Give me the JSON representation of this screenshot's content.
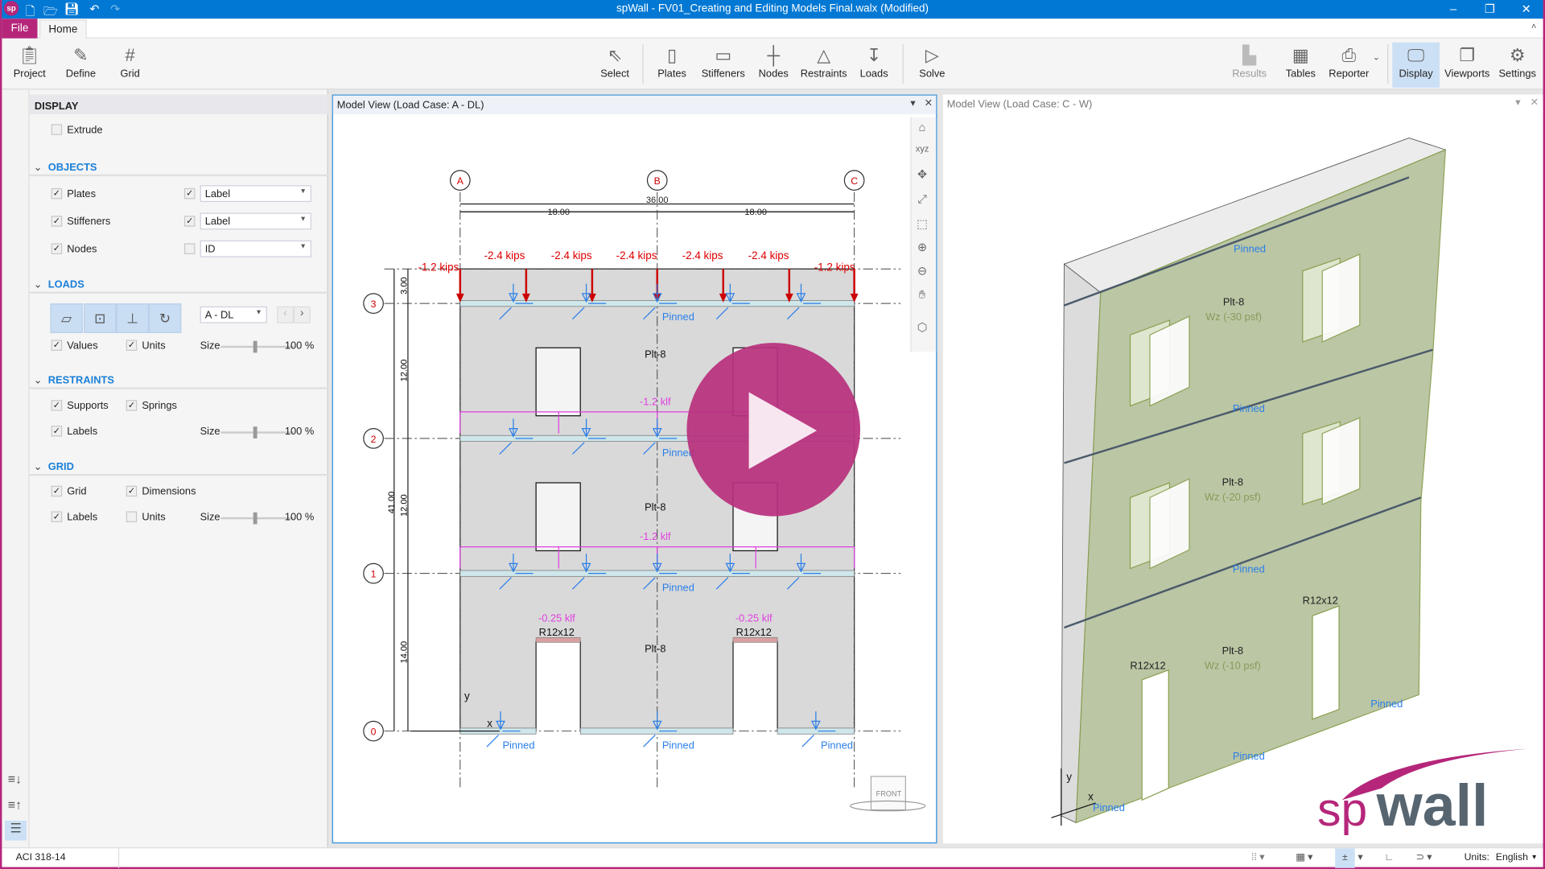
{
  "app": {
    "title": "spWall - FV01_Creating and Editing Models Final.walx (Modified)",
    "logo_text": "sp",
    "brand_color": "#b5267a",
    "titlebar_color": "#0078d4"
  },
  "quick_access": {
    "icons": [
      "new-file-icon",
      "open-folder-icon",
      "save-icon",
      "undo-icon",
      "redo-icon"
    ]
  },
  "window_controls": {
    "minimize": "–",
    "restore": "❐",
    "close": "✕"
  },
  "tabs": {
    "file": "File",
    "home": "Home"
  },
  "ribbon": {
    "project": "Project",
    "define": "Define",
    "grid": "Grid",
    "select": "Select",
    "plates": "Plates",
    "stiffeners": "Stiffeners",
    "nodes": "Nodes",
    "restraints": "Restraints",
    "loads": "Loads",
    "solve": "Solve",
    "results": "Results",
    "tables": "Tables",
    "reporter": "Reporter",
    "display": "Display",
    "viewports": "Viewports",
    "settings": "Settings"
  },
  "panel": {
    "title": "DISPLAY",
    "extrude": {
      "label": "Extrude",
      "checked": false
    },
    "objects": {
      "header": "OBJECTS",
      "rows": [
        {
          "label": "Plates",
          "checked": true,
          "show_label": true,
          "option": "Label"
        },
        {
          "label": "Stiffeners",
          "checked": true,
          "show_label": true,
          "option": "Label"
        },
        {
          "label": "Nodes",
          "checked": true,
          "show_label": false,
          "option": "ID"
        }
      ]
    },
    "loads": {
      "header": "LOADS",
      "load_case": "A - DL",
      "values": "Values",
      "units": "Units",
      "size_label": "Size",
      "size": "100 %"
    },
    "restraints": {
      "header": "RESTRAINTS",
      "supports": "Supports",
      "springs": "Springs",
      "labels": "Labels",
      "size_label": "Size",
      "size": "100 %"
    },
    "grid": {
      "header": "GRID",
      "grid": "Grid",
      "dimensions": "Dimensions",
      "labels": "Labels",
      "units": "Units",
      "size_label": "Size",
      "size": "100 %"
    }
  },
  "view_left": {
    "title": "Model View (Load Case: A - DL)",
    "grid_x": [
      "A",
      "B",
      "C"
    ],
    "grid_y": [
      "3",
      "2",
      "1",
      "0"
    ],
    "dim_total": "36.00",
    "dim_spans": [
      "18.00",
      "18.00"
    ],
    "dim_vertical": [
      "3.00",
      "12.00",
      "41.00",
      "12.00",
      "14.00"
    ],
    "point_loads": [
      "-1.2 kips",
      "-2.4 kips",
      "-2.4 kips",
      "-2.4 kips",
      "-2.4 kips",
      "-2.4 kips",
      "-1.2 kips"
    ],
    "line_loads": [
      "-1.2 klf",
      "-1.2 klf",
      "-0.25 klf",
      "-0.25 klf"
    ],
    "stiffeners": [
      "R12x12",
      "R12x12"
    ],
    "plates": [
      "Plt-8",
      "Plt-8",
      "Plt-8"
    ],
    "restraint_label": "Pinned",
    "axis_x": "x",
    "axis_y": "y",
    "view_cube": "FRONT",
    "play_button_color": "#b8307d"
  },
  "view_right": {
    "title": "Model View (Load Case: C - W)",
    "plates": [
      {
        "name": "Plt-8",
        "load": "Wz (-30 psf)"
      },
      {
        "name": "Plt-8",
        "load": "Wz (-20 psf)"
      },
      {
        "name": "Plt-8",
        "load": "Wz (-10 psf)"
      }
    ],
    "stiffeners": [
      "R12x12",
      "R12x12"
    ],
    "restraint_label": "Pinned",
    "axis_x": "x",
    "axis_y": "y",
    "logo": "spwall"
  },
  "status": {
    "code": "ACI 318-14",
    "units_label": "Units:",
    "units": "English"
  }
}
